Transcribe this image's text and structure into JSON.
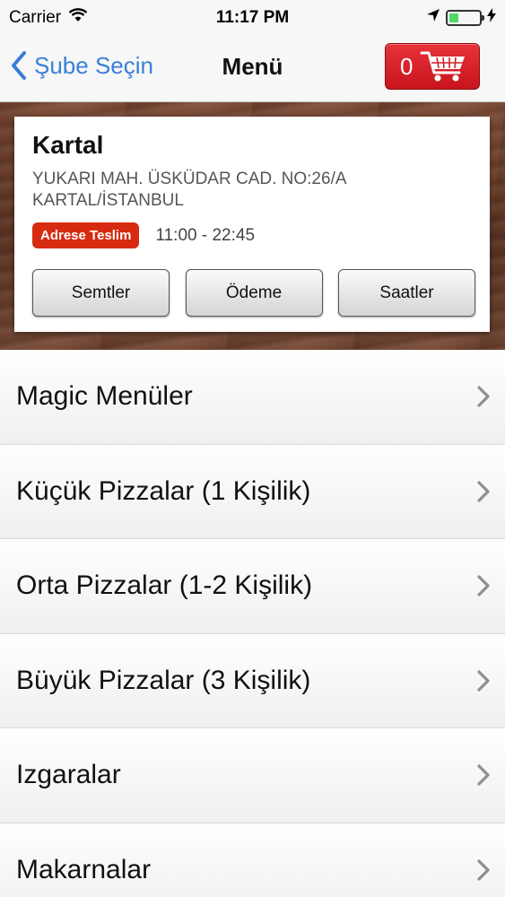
{
  "status_bar": {
    "carrier": "Carrier",
    "time": "11:17 PM"
  },
  "nav": {
    "back_label": "Şube Seçin",
    "title": "Menü",
    "cart_count": "0"
  },
  "store": {
    "name": "Kartal",
    "address_line1": "YUKARI MAH. ÜSKÜDAR CAD. NO:26/A",
    "address_line2": "KARTAL/İSTANBUL",
    "delivery_badge": "Adrese Teslim",
    "hours": "11:00 - 22:45",
    "buttons": {
      "districts": "Semtler",
      "payment": "Ödeme",
      "hours": "Saatler"
    }
  },
  "menu": {
    "items": [
      {
        "label": "Magic Menüler"
      },
      {
        "label": "Küçük Pizzalar (1 Kişilik)"
      },
      {
        "label": "Orta Pizzalar (1-2 Kişilik)"
      },
      {
        "label": "Büyük Pizzalar (3 Kişilik)"
      },
      {
        "label": "Izgaralar"
      },
      {
        "label": "Makarnalar"
      }
    ]
  },
  "colors": {
    "accent_blue": "#3a7fd6",
    "cart_red": "#d91f27",
    "badge_red": "#d62b10",
    "battery_green": "#4cd964"
  }
}
